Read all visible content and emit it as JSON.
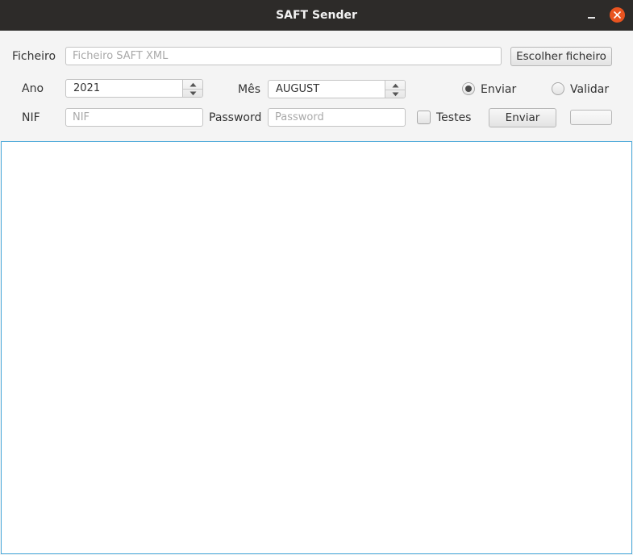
{
  "window": {
    "title": "SAFT Sender"
  },
  "file": {
    "label": "Ficheiro",
    "value": "",
    "placeholder": "Ficheiro SAFT XML",
    "choose_button": "Escolher ficheiro"
  },
  "year": {
    "label": "Ano",
    "value": "2021"
  },
  "month": {
    "label": "Mês",
    "value": "AUGUST"
  },
  "mode": {
    "options": [
      {
        "label": "Enviar",
        "selected": true
      },
      {
        "label": "Validar",
        "selected": false
      }
    ]
  },
  "nif": {
    "label": "NIF",
    "value": "",
    "placeholder": "NIF"
  },
  "password": {
    "label": "Password",
    "value": "",
    "placeholder": "Password"
  },
  "tests": {
    "label": "Testes",
    "checked": false
  },
  "send_button": {
    "label": "Enviar"
  },
  "colors": {
    "titlebar": "#2d2b29",
    "close_button": "#e95420",
    "output_border": "#48a7d9"
  }
}
